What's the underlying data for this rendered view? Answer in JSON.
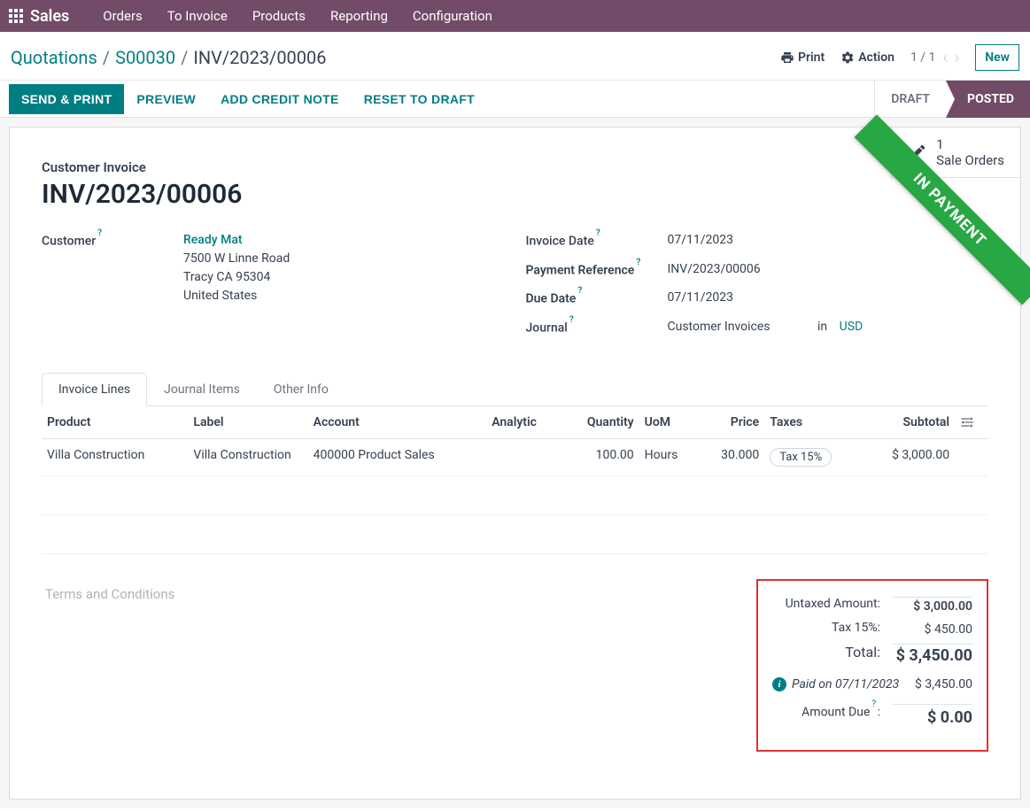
{
  "nav": {
    "brand": "Sales",
    "items": [
      "Orders",
      "To Invoice",
      "Products",
      "Reporting",
      "Configuration"
    ]
  },
  "breadcrumb": {
    "items": [
      "Quotations",
      "S00030"
    ],
    "current": "INV/2023/00006"
  },
  "header_actions": {
    "print": "Print",
    "action": "Action",
    "pager": "1 / 1",
    "new": "New"
  },
  "buttons": {
    "send_print": "SEND & PRINT",
    "preview": "PREVIEW",
    "add_credit": "ADD CREDIT NOTE",
    "reset": "RESET TO DRAFT"
  },
  "status": {
    "draft": "DRAFT",
    "posted": "POSTED"
  },
  "statbox": {
    "count": "1",
    "label": "Sale Orders"
  },
  "ribbon": "IN PAYMENT",
  "doc": {
    "type": "Customer Invoice",
    "name": "INV/2023/00006"
  },
  "customer": {
    "label": "Customer",
    "name": "Ready Mat",
    "line1": "7500 W Linne Road",
    "line2": "Tracy CA 95304",
    "line3": "United States"
  },
  "right_fields": {
    "invoice_date_label": "Invoice Date",
    "invoice_date": "07/11/2023",
    "payment_ref_label": "Payment Reference",
    "payment_ref": "INV/2023/00006",
    "due_date_label": "Due Date",
    "due_date": "07/11/2023",
    "journal_label": "Journal",
    "journal": "Customer Invoices",
    "journal_in": "in",
    "currency": "USD"
  },
  "tabs": [
    "Invoice Lines",
    "Journal Items",
    "Other Info"
  ],
  "columns": {
    "product": "Product",
    "label": "Label",
    "account": "Account",
    "analytic": "Analytic",
    "quantity": "Quantity",
    "uom": "UoM",
    "price": "Price",
    "taxes": "Taxes",
    "subtotal": "Subtotal"
  },
  "lines": [
    {
      "product": "Villa Construction",
      "label": "Villa Construction",
      "account": "400000 Product Sales",
      "analytic": "",
      "quantity": "100.00",
      "uom": "Hours",
      "price": "30.000",
      "taxes": "Tax 15%",
      "subtotal": "$ 3,000.00"
    }
  ],
  "terms_placeholder": "Terms and Conditions",
  "totals": {
    "untaxed_label": "Untaxed Amount:",
    "untaxed": "$ 3,000.00",
    "tax_label": "Tax 15%:",
    "tax": "$ 450.00",
    "total_label": "Total:",
    "total": "$ 3,450.00",
    "paid_label": "Paid on 07/11/2023",
    "paid": "$ 3,450.00",
    "due_label": "Amount Due",
    "due_colon": " :",
    "due": "$ 0.00"
  }
}
